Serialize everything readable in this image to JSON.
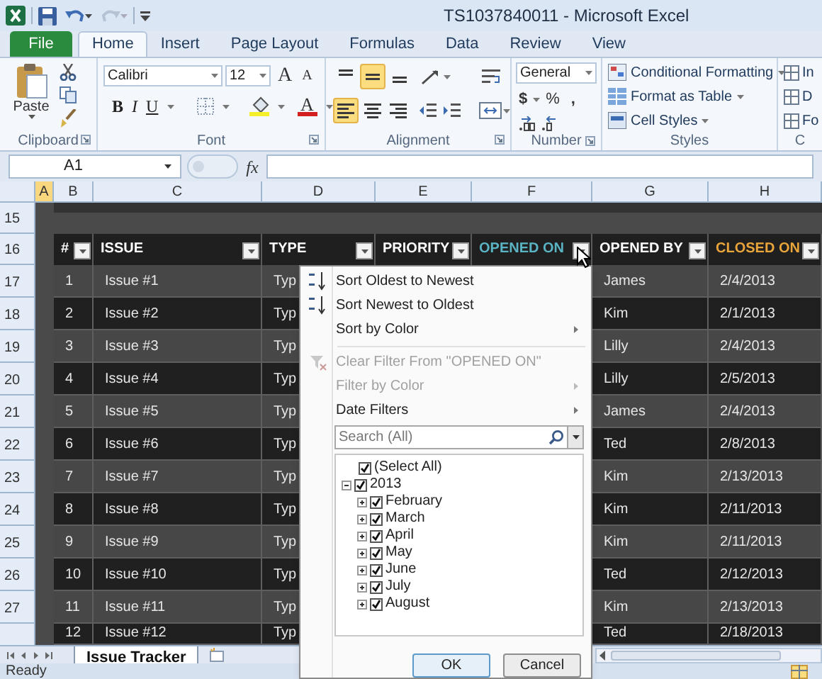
{
  "window": {
    "title": "TS1037840011 - Microsoft Excel"
  },
  "ribbon_tabs": [
    {
      "label": "File",
      "kind": "file",
      "selected": false
    },
    {
      "label": "Home",
      "kind": "tab",
      "selected": true
    },
    {
      "label": "Insert",
      "kind": "tab",
      "selected": false
    },
    {
      "label": "Page Layout",
      "kind": "tab",
      "selected": false
    },
    {
      "label": "Formulas",
      "kind": "tab",
      "selected": false
    },
    {
      "label": "Data",
      "kind": "tab",
      "selected": false
    },
    {
      "label": "Review",
      "kind": "tab",
      "selected": false
    },
    {
      "label": "View",
      "kind": "tab",
      "selected": false
    }
  ],
  "clipboard": {
    "paste_label": "Paste",
    "group_label": "Clipboard"
  },
  "font": {
    "name": "Calibri",
    "size": "12",
    "grow_label": "A",
    "shrink_label": "A",
    "bold_label": "B",
    "italic_label": "I",
    "underline_label": "U",
    "font_color_label": "A",
    "group_label": "Font"
  },
  "alignment": {
    "vertical": [
      {
        "selected": false
      },
      {
        "selected": true
      },
      {
        "selected": false
      }
    ],
    "horizontal": [
      {
        "selected": true
      },
      {
        "selected": false
      },
      {
        "selected": false
      }
    ],
    "group_label": "Alignment"
  },
  "number": {
    "format": "General",
    "currency": "$",
    "percent": "%",
    "comma": ",",
    "group_label": "Number"
  },
  "styles": {
    "items": [
      "Conditional Formatting",
      "Format as Table",
      "Cell Styles"
    ],
    "group_label": "Styles"
  },
  "cells": {
    "items": [
      "In",
      "D",
      "Fo"
    ],
    "group_label": "C"
  },
  "formula_bar": {
    "name_box": "A1",
    "function_label": "fx"
  },
  "column_headers": [
    {
      "label": "A",
      "selected": true
    },
    {
      "label": "B",
      "selected": false
    },
    {
      "label": "C",
      "selected": false
    },
    {
      "label": "D",
      "selected": false
    },
    {
      "label": "E",
      "selected": false
    },
    {
      "label": "F",
      "selected": false
    },
    {
      "label": "G",
      "selected": false
    },
    {
      "label": "H",
      "selected": false
    }
  ],
  "blank_rows": [
    "15"
  ],
  "table": {
    "header_row": "16",
    "columns": [
      {
        "label": "#",
        "color": "#ffffff"
      },
      {
        "label": "ISSUE",
        "color": "#ffffff"
      },
      {
        "label": "TYPE",
        "color": "#ffffff"
      },
      {
        "label": "PRIORITY",
        "color": "#ffffff"
      },
      {
        "label": "OPENED ON",
        "color": "#5ab4c4"
      },
      {
        "label": "OPENED BY",
        "color": "#ffffff"
      },
      {
        "label": "CLOSED ON",
        "color": "#e9a53a"
      }
    ],
    "rows": [
      {
        "sheet_row": "17",
        "number": "1",
        "issue": "Issue #1",
        "type": "Typ",
        "opened_by": "James",
        "closed_on": "2/4/2013"
      },
      {
        "sheet_row": "18",
        "number": "2",
        "issue": "Issue #2",
        "type": "Typ",
        "opened_by": "Kim",
        "closed_on": "2/1/2013"
      },
      {
        "sheet_row": "19",
        "number": "3",
        "issue": "Issue #3",
        "type": "Typ",
        "opened_by": "Lilly",
        "closed_on": "2/4/2013"
      },
      {
        "sheet_row": "20",
        "number": "4",
        "issue": "Issue #4",
        "type": "Typ",
        "opened_by": "Lilly",
        "closed_on": "2/5/2013"
      },
      {
        "sheet_row": "21",
        "number": "5",
        "issue": "Issue #5",
        "type": "Typ",
        "opened_by": "James",
        "closed_on": "2/4/2013"
      },
      {
        "sheet_row": "22",
        "number": "6",
        "issue": "Issue #6",
        "type": "Typ",
        "opened_by": "Ted",
        "closed_on": "2/8/2013"
      },
      {
        "sheet_row": "23",
        "number": "7",
        "issue": "Issue #7",
        "type": "Typ",
        "opened_by": "Kim",
        "closed_on": "2/13/2013"
      },
      {
        "sheet_row": "24",
        "number": "8",
        "issue": "Issue #8",
        "type": "Typ",
        "opened_by": "Kim",
        "closed_on": "2/11/2013"
      },
      {
        "sheet_row": "25",
        "number": "9",
        "issue": "Issue #9",
        "type": "Typ",
        "opened_by": "Kim",
        "closed_on": "2/11/2013"
      },
      {
        "sheet_row": "26",
        "number": "10",
        "issue": "Issue #10",
        "type": "Typ",
        "opened_by": "Ted",
        "closed_on": "2/12/2013"
      },
      {
        "sheet_row": "27",
        "number": "11",
        "issue": "Issue #11",
        "type": "Typ",
        "opened_by": "Kim",
        "closed_on": "2/13/2013"
      },
      {
        "number": "12",
        "issue": "Issue #12",
        "type": "Typ",
        "opened_by": "Ted",
        "closed_on": "2/18/2013"
      }
    ]
  },
  "filter_menu": {
    "items": [
      {
        "label": "Sort Oldest to Newest",
        "kind": "sort_asc",
        "disabled": false,
        "submenu": false
      },
      {
        "label": "Sort Newest to Oldest",
        "kind": "sort_desc",
        "disabled": false,
        "submenu": false
      },
      {
        "label": "Sort by Color",
        "kind": "plain",
        "disabled": false,
        "submenu": true
      },
      {
        "label": "Clear Filter From \"OPENED ON\"",
        "kind": "clear_filter",
        "disabled": true,
        "submenu": false
      },
      {
        "label": "Filter by Color",
        "kind": "plain",
        "disabled": true,
        "submenu": true
      },
      {
        "label": "Date Filters",
        "kind": "plain",
        "disabled": false,
        "submenu": true
      }
    ],
    "search": {
      "placeholder": "Search (All)"
    },
    "tree": [
      {
        "label": "(Select All)",
        "checked": true
      },
      {
        "label": "2013",
        "checked": true,
        "expanded": true,
        "children": [
          {
            "label": "February",
            "checked": true,
            "expanded": false
          },
          {
            "label": "March",
            "checked": true,
            "expanded": false
          },
          {
            "label": "April",
            "checked": true,
            "expanded": false
          },
          {
            "label": "May",
            "checked": true,
            "expanded": false
          },
          {
            "label": "June",
            "checked": true,
            "expanded": false
          },
          {
            "label": "July",
            "checked": true,
            "expanded": false
          },
          {
            "label": "August",
            "checked": true,
            "expanded": false
          }
        ]
      }
    ],
    "buttons": [
      "OK",
      "Cancel"
    ]
  },
  "sheet_tabs": [
    {
      "label": "Issue Tracker",
      "selected": true
    }
  ],
  "status_bar": {
    "text": "Ready"
  }
}
